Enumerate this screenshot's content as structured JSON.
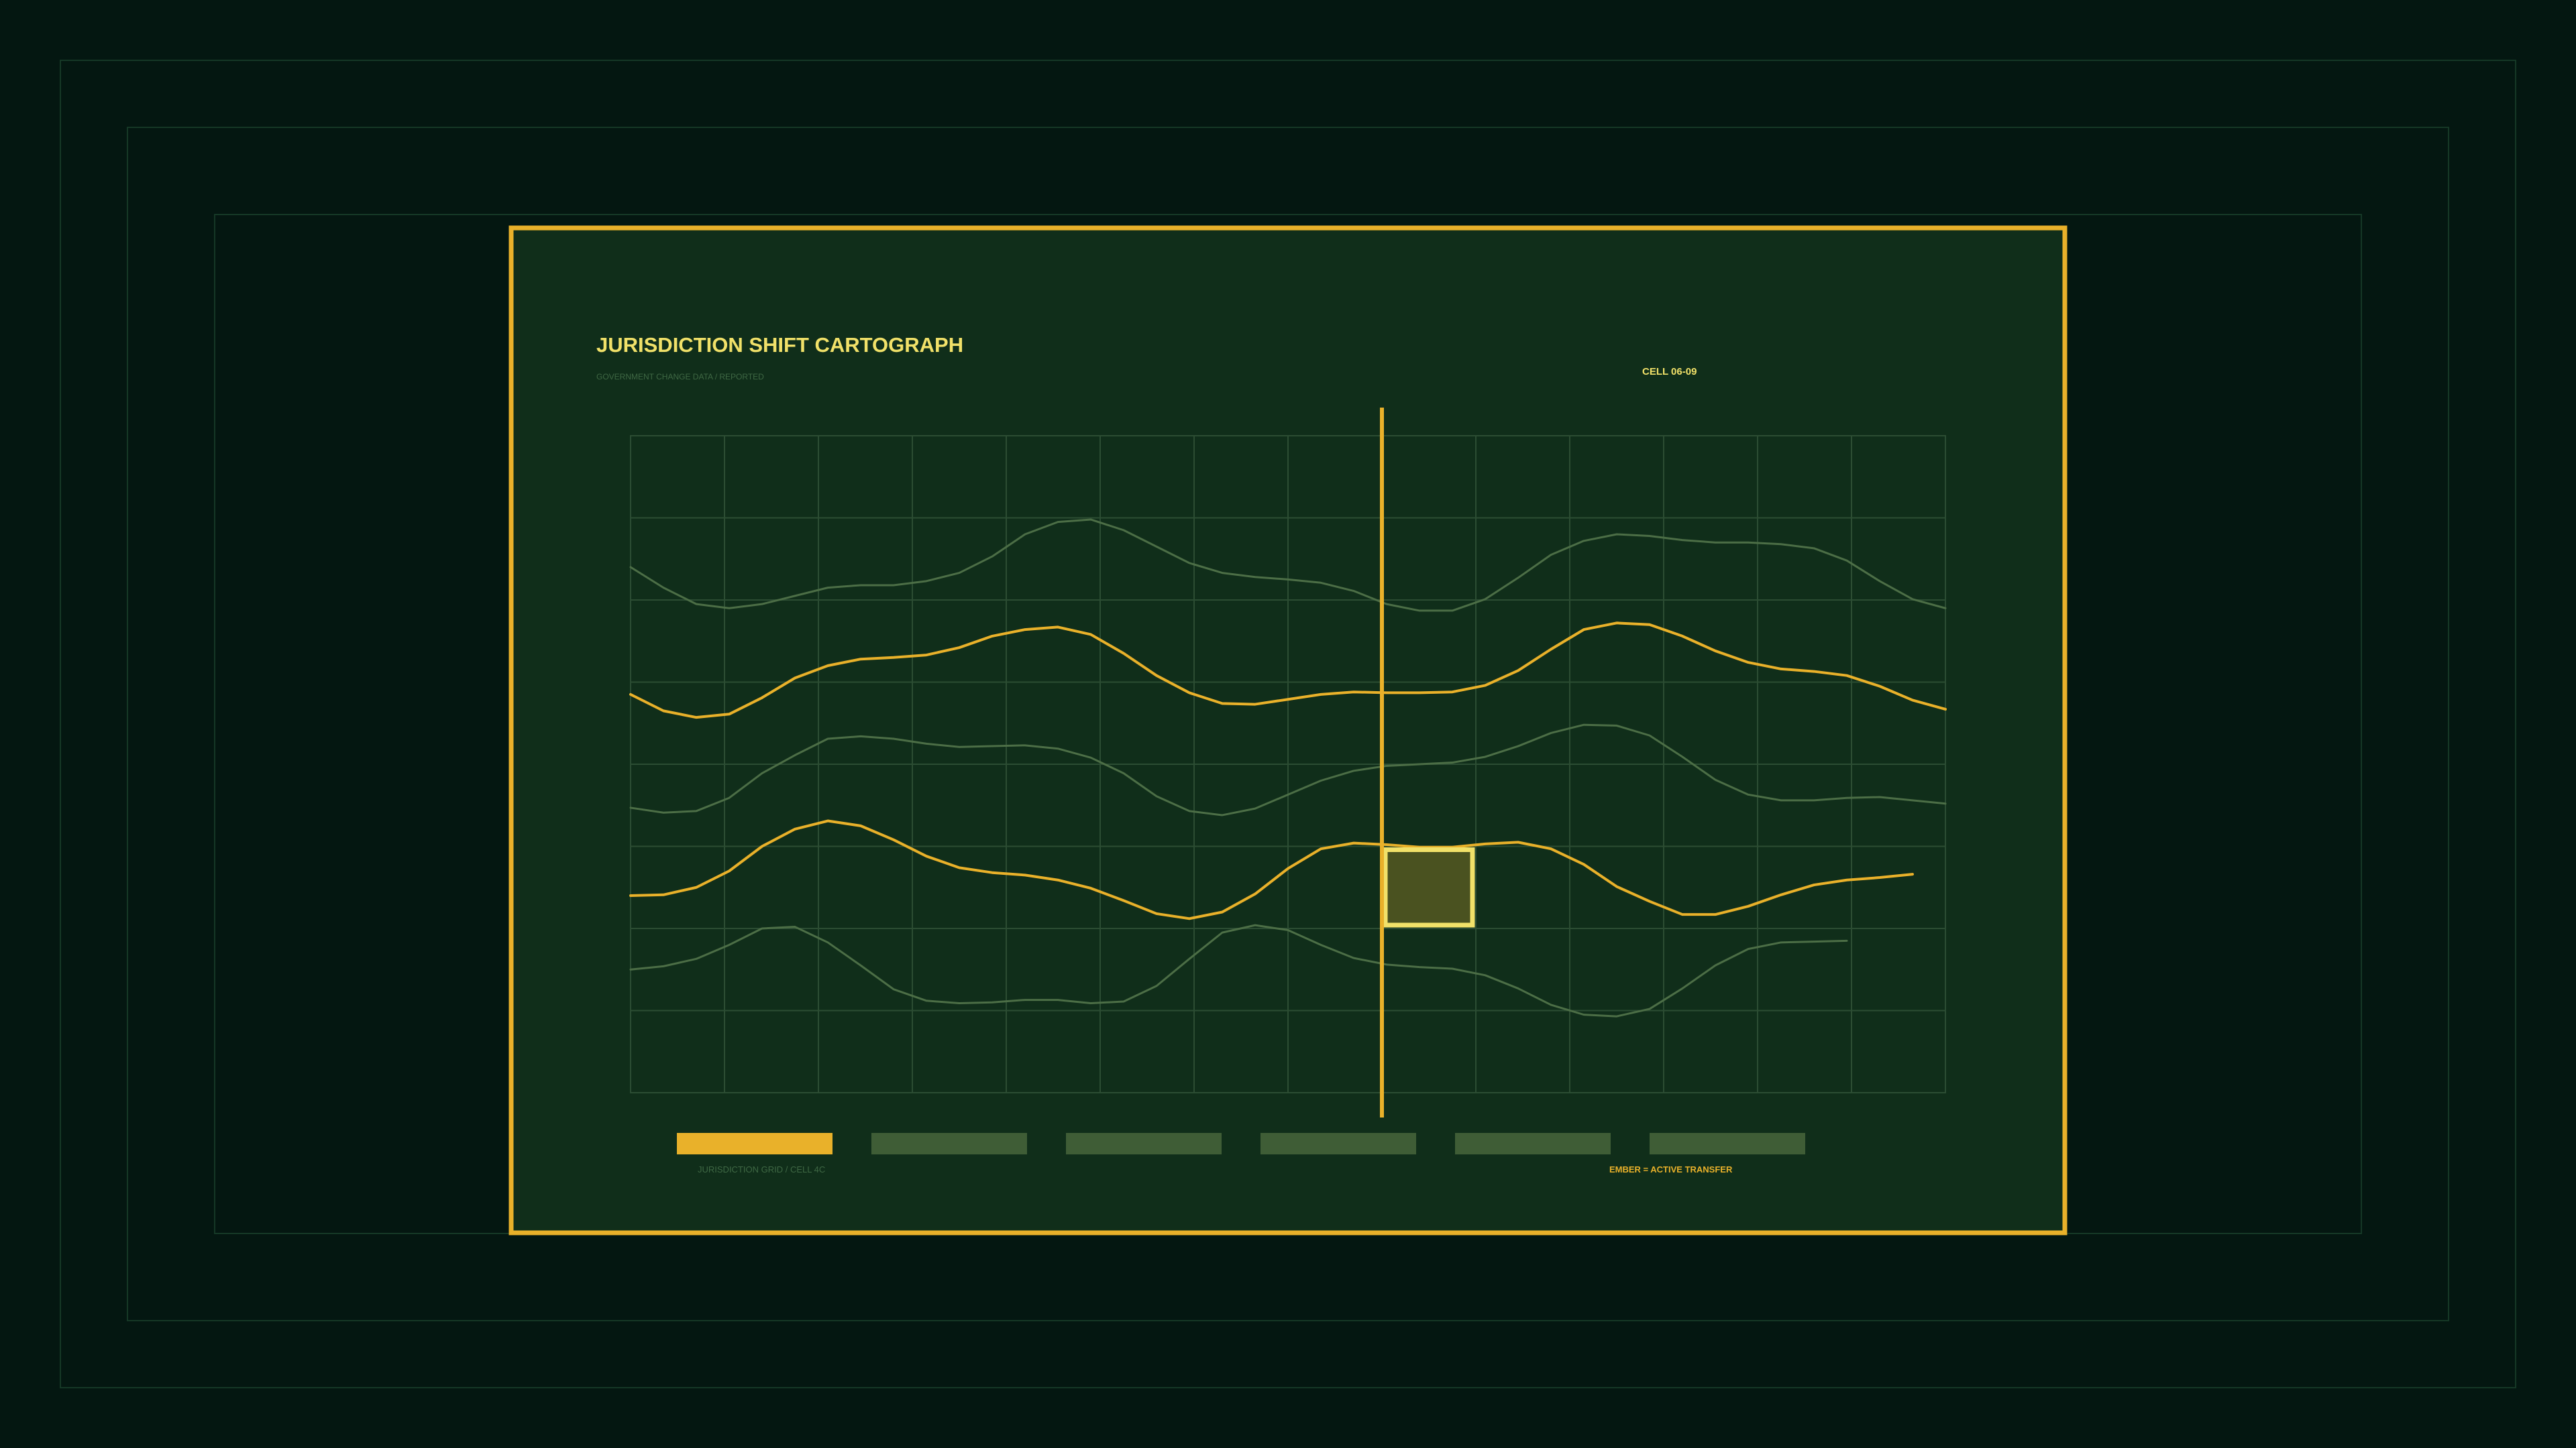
{
  "header": {
    "title": "JURISDICTION SHIFT CARTOGRAPH",
    "subtitle": "GOVERNMENT CHANGE DATA / REPORTED",
    "cell_id": "CELL 06-09"
  },
  "footer": {
    "left_label": "JURISDICTION GRID / CELL 4C",
    "right_label": "EMBER = ACTIVE TRANSFER"
  },
  "colors": {
    "background": "#041711",
    "panel": "#102e1a",
    "accent": "#e9b12a",
    "highlight_text": "#f1e169",
    "muted_line": "#4c6e46",
    "grid": "#2c4d33",
    "muted_block": "#3f5d36",
    "cell_fill": "#4a5220"
  },
  "chart_data": {
    "type": "line",
    "grid": {
      "columns": 14,
      "rows": 8
    },
    "x_range": [
      0,
      40
    ],
    "y_range": [
      0,
      80
    ],
    "cursor_column": 8,
    "highlight_cell": {
      "col": 8,
      "row": 5
    },
    "series": [
      {
        "style": "muted",
        "values": [
          64,
          61.5,
          59.5,
          59,
          59.5,
          60.5,
          61.5,
          61.8,
          61.8,
          62.3,
          63.3,
          65.3,
          68,
          69.5,
          69.8,
          68.5,
          66.5,
          64.5,
          63.3,
          62.8,
          62.5,
          62.1,
          61.1,
          59.5,
          58.7,
          58.7,
          60.1,
          62.7,
          65.5,
          67.2,
          68,
          67.8,
          67.3,
          67,
          67,
          66.8,
          66.3,
          64.8,
          62.3,
          60.1,
          59
        ]
      },
      {
        "style": "accent",
        "values": [
          48.5,
          46.5,
          45.7,
          46.1,
          48.1,
          50.5,
          52,
          52.8,
          53,
          53.3,
          54.2,
          55.6,
          56.4,
          56.7,
          55.8,
          53.5,
          50.8,
          48.7,
          47.4,
          47.3,
          47.9,
          48.5,
          48.8,
          48.7,
          48.7,
          48.8,
          49.6,
          51.4,
          54,
          56.4,
          57.2,
          57,
          55.6,
          53.8,
          52.4,
          51.6,
          51.3,
          50.8,
          49.5,
          47.8,
          46.7
        ]
      },
      {
        "style": "muted",
        "values": [
          34.7,
          34.1,
          34.3,
          35.9,
          38.9,
          41.1,
          43.1,
          43.4,
          43.1,
          42.5,
          42.1,
          42.2,
          42.3,
          41.9,
          40.8,
          38.9,
          36.1,
          34.3,
          33.8,
          34.6,
          36.3,
          38,
          39.2,
          39.8,
          40,
          40.2,
          40.9,
          42.2,
          43.8,
          44.8,
          44.7,
          43.5,
          40.9,
          38.1,
          36.3,
          35.6,
          35.6,
          35.9,
          36,
          35.6,
          35.2
        ]
      },
      {
        "style": "accent",
        "values": [
          24,
          24.1,
          25,
          27,
          30,
          32.1,
          33.1,
          32.5,
          30.8,
          28.8,
          27.4,
          26.8,
          26.5,
          25.9,
          24.9,
          23.4,
          21.8,
          21.2,
          22,
          24.2,
          27.3,
          29.7,
          30.4,
          30.2,
          29.9,
          29.9,
          30.3,
          30.5,
          29.7,
          27.8,
          25.1,
          23.3,
          21.7,
          21.7,
          22.7,
          24.1,
          25.3,
          25.9,
          26.2,
          26.6
        ]
      },
      {
        "style": "muted",
        "values": [
          15,
          15.4,
          16.3,
          18,
          20,
          20.2,
          18.3,
          15.5,
          12.6,
          11.2,
          10.9,
          11,
          11.3,
          11.3,
          10.9,
          11.1,
          13,
          16.3,
          19.5,
          20.4,
          19.8,
          18,
          16.4,
          15.6,
          15.3,
          15.1,
          14.3,
          12.7,
          10.7,
          9.5,
          9.3,
          10.2,
          12.7,
          15.5,
          17.5,
          18.3,
          18.4,
          18.5
        ]
      }
    ]
  }
}
